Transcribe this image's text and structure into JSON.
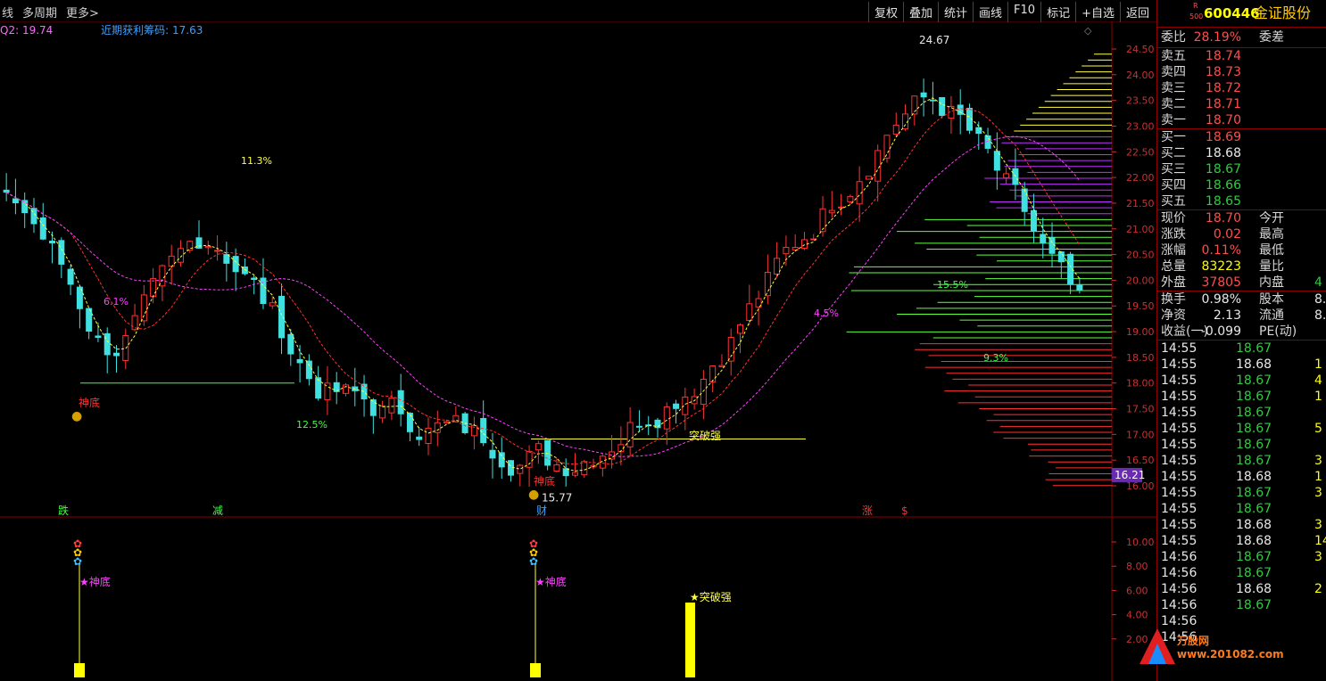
{
  "toolbar": {
    "left": [
      "线",
      "多周期",
      "更多>"
    ],
    "right": [
      "复权",
      "叠加",
      "统计",
      "画线",
      "F10",
      "标记",
      "+自选",
      "返回"
    ]
  },
  "indicator_line": {
    "q2": "Q2: 19.74",
    "profit_chips": "近期获利筹码: 17.63"
  },
  "main_axis": [
    "24.50",
    "24.00",
    "23.50",
    "23.00",
    "22.50",
    "22.00",
    "21.50",
    "21.00",
    "20.50",
    "20.00",
    "19.50",
    "19.00",
    "18.50",
    "18.00",
    "17.50",
    "17.00",
    "16.50",
    "16.00"
  ],
  "current_price_tag": "16.21",
  "sub_axis": [
    "10.00",
    "8.00",
    "6.00",
    "4.00",
    "2.00"
  ],
  "annotations": {
    "high": "24.67",
    "low": "15.77",
    "pct": [
      "11.3%",
      "6.1%",
      "12.5%",
      "4.5%",
      "15.5%",
      "9.3%"
    ],
    "signals": [
      "神底",
      "神底",
      "突破强"
    ],
    "markers": [
      "跌",
      "减",
      "财",
      "涨",
      "$"
    ],
    "sub_signals": [
      "★神底",
      "★神底",
      "★突破强"
    ]
  },
  "quote": {
    "code": "600446",
    "name": "金证股份",
    "badge_top": "R",
    "badge_bottom": "500",
    "weibi_label": "委比",
    "weibi_value": "28.19%",
    "weicha_label": "委差",
    "asks": [
      {
        "label": "卖五",
        "price": "18.74"
      },
      {
        "label": "卖四",
        "price": "18.73"
      },
      {
        "label": "卖三",
        "price": "18.72"
      },
      {
        "label": "卖二",
        "price": "18.71"
      },
      {
        "label": "卖一",
        "price": "18.70"
      }
    ],
    "bids": [
      {
        "label": "买一",
        "price": "18.69",
        "color": "red"
      },
      {
        "label": "买二",
        "price": "18.68",
        "color": "white"
      },
      {
        "label": "买三",
        "price": "18.67",
        "color": "green"
      },
      {
        "label": "买四",
        "price": "18.66",
        "color": "green"
      },
      {
        "label": "买五",
        "price": "18.65",
        "color": "green"
      }
    ],
    "stats": [
      {
        "l": "现价",
        "v": "18.70",
        "c": "red",
        "l2": "今开"
      },
      {
        "l": "涨跌",
        "v": "0.02",
        "c": "red",
        "l2": "最高"
      },
      {
        "l": "涨幅",
        "v": "0.11%",
        "c": "red",
        "l2": "最低"
      },
      {
        "l": "总量",
        "v": "83223",
        "c": "yellow",
        "l2": "量比"
      },
      {
        "l": "外盘",
        "v": "37805",
        "c": "red",
        "l2": "内盘",
        "v2": "4"
      }
    ],
    "stats2": [
      {
        "l": "换手",
        "v": "0.98%",
        "c": "white",
        "l2": "股本",
        "v2": "8."
      },
      {
        "l": "净资",
        "v": "2.13",
        "c": "white",
        "l2": "流通",
        "v2": "8."
      },
      {
        "l": "收益(一)",
        "v": "-0.099",
        "c": "white",
        "l2": "PE(动)",
        "v2": ""
      }
    ],
    "ticks": [
      {
        "t": "14:55",
        "p": "18.67",
        "c": "green",
        "v": ""
      },
      {
        "t": "14:55",
        "p": "18.68",
        "c": "white",
        "v": "1"
      },
      {
        "t": "14:55",
        "p": "18.67",
        "c": "green",
        "v": "4"
      },
      {
        "t": "14:55",
        "p": "18.67",
        "c": "green",
        "v": "1"
      },
      {
        "t": "14:55",
        "p": "18.67",
        "c": "green",
        "v": ""
      },
      {
        "t": "14:55",
        "p": "18.67",
        "c": "green",
        "v": "5"
      },
      {
        "t": "14:55",
        "p": "18.67",
        "c": "green",
        "v": ""
      },
      {
        "t": "14:55",
        "p": "18.67",
        "c": "green",
        "v": "3"
      },
      {
        "t": "14:55",
        "p": "18.68",
        "c": "white",
        "v": "1"
      },
      {
        "t": "14:55",
        "p": "18.67",
        "c": "green",
        "v": "3"
      },
      {
        "t": "14:55",
        "p": "18.67",
        "c": "green",
        "v": ""
      },
      {
        "t": "14:55",
        "p": "18.68",
        "c": "white",
        "v": "3"
      },
      {
        "t": "14:55",
        "p": "18.68",
        "c": "white",
        "v": "14"
      },
      {
        "t": "14:56",
        "p": "18.67",
        "c": "green",
        "v": "3"
      },
      {
        "t": "14:56",
        "p": "18.67",
        "c": "green",
        "v": ""
      },
      {
        "t": "14:56",
        "p": "18.68",
        "c": "white",
        "v": "2"
      },
      {
        "t": "14:56",
        "p": "18.67",
        "c": "green",
        "v": ""
      },
      {
        "t": "14:56",
        "p": "",
        "c": "white",
        "v": ""
      },
      {
        "t": "14:56",
        "p": "",
        "c": "white",
        "v": ""
      }
    ]
  },
  "watermark": "万股网 www.201082.com"
}
